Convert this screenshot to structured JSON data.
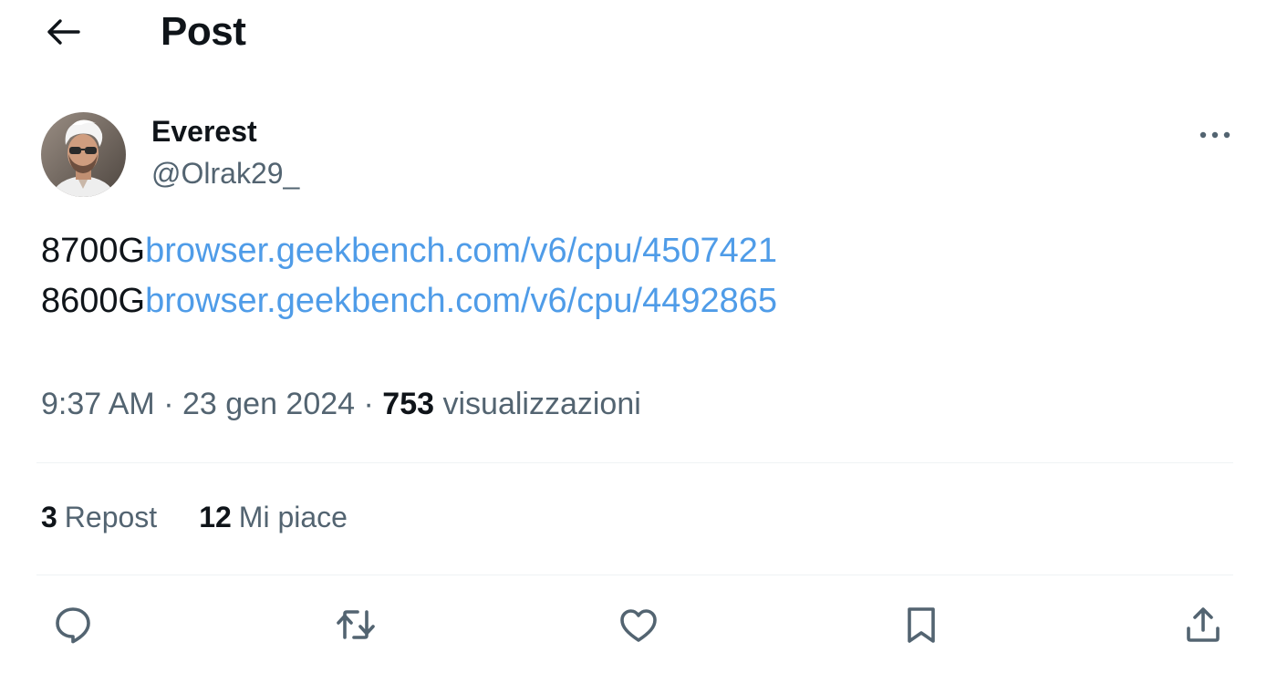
{
  "header": {
    "back_icon": "arrow-left-icon",
    "title": "Post"
  },
  "author": {
    "name": "Everest",
    "handle": "@Olrak29_",
    "more_icon": "more-horizontal-icon"
  },
  "tweet": {
    "lines": [
      {
        "prefix": "8700G",
        "link": "browser.geekbench.com/v6/cpu/4507421"
      },
      {
        "prefix": "8600G",
        "link": "browser.geekbench.com/v6/cpu/4492865"
      }
    ]
  },
  "meta": {
    "time": "9:37 AM",
    "separator": "·",
    "date": "23 gen 2024",
    "views_count": "753",
    "views_label": "visualizzazioni"
  },
  "stats": {
    "reposts_count": "3",
    "reposts_label": "Repost",
    "likes_count": "12",
    "likes_label": "Mi piace"
  },
  "actions": [
    {
      "icon": "reply-icon"
    },
    {
      "icon": "repost-icon"
    },
    {
      "icon": "like-icon"
    },
    {
      "icon": "bookmark-icon"
    },
    {
      "icon": "share-icon"
    }
  ],
  "colors": {
    "text_primary": "#0f1419",
    "text_secondary": "#536471",
    "link": "#4f9ce8",
    "divider": "#eff3f4"
  }
}
